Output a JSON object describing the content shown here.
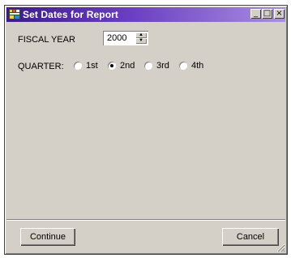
{
  "window": {
    "title": "Set Dates for Report",
    "controls": {
      "minimize": "_",
      "maximize": "□",
      "close": "×"
    }
  },
  "form": {
    "fiscal_year_label": "FISCAL YEAR",
    "fiscal_year_value": "2000",
    "quarter_label": "QUARTER:",
    "quarters": [
      {
        "label": "1st",
        "selected": false
      },
      {
        "label": "2nd",
        "selected": true
      },
      {
        "label": "3rd",
        "selected": false
      },
      {
        "label": "4th",
        "selected": false
      }
    ]
  },
  "buttons": {
    "continue_label": "Continue",
    "cancel_label": "Cancel"
  },
  "colors": {
    "titlebar_start": "#3c1b8c",
    "titlebar_end": "#a98fe0",
    "face": "#d4d0c8"
  }
}
